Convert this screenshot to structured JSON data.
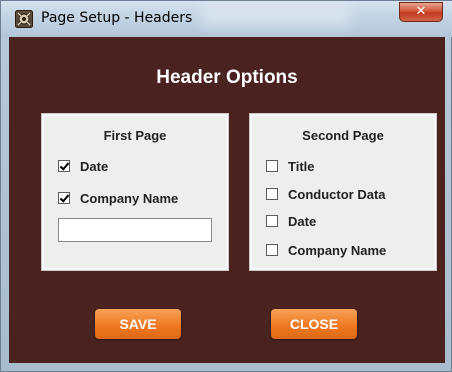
{
  "window": {
    "title": "Page Setup - Headers",
    "close_glyph": "✕"
  },
  "dialog": {
    "heading": "Header Options",
    "first_page": {
      "title": "First Page",
      "checkboxes": [
        {
          "label": "Date",
          "checked": true
        },
        {
          "label": "Company Name",
          "checked": true
        }
      ],
      "input_value": ""
    },
    "second_page": {
      "title": "Second Page",
      "checkboxes": [
        {
          "label": "Title",
          "checked": false
        },
        {
          "label": "Conductor Data",
          "checked": false
        },
        {
          "label": "Date",
          "checked": false
        },
        {
          "label": "Company Name",
          "checked": false
        }
      ]
    },
    "buttons": {
      "save": "SAVE",
      "close": "CLOSE"
    }
  },
  "colors": {
    "background": "#4a2320",
    "panel": "#eeeeee",
    "button": "#ef7a24",
    "button_text": "#ffffff"
  },
  "icons": {
    "app": "app-icon",
    "window_close": "close-icon"
  }
}
